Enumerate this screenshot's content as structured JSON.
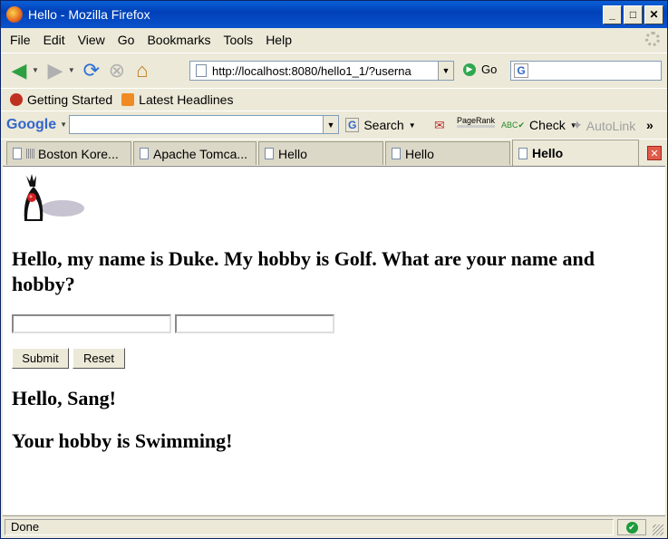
{
  "window": {
    "title": "Hello - Mozilla Firefox",
    "minimize": "_",
    "maximize": "□",
    "close": "✕"
  },
  "menu": [
    "File",
    "Edit",
    "View",
    "Go",
    "Bookmarks",
    "Tools",
    "Help"
  ],
  "nav": {
    "url": "http://localhost:8080/hello1_1/?userna",
    "go_label": "Go"
  },
  "bookmarks": [
    {
      "label": "Getting Started"
    },
    {
      "label": "Latest Headlines"
    }
  ],
  "google_bar": {
    "logo": "Google",
    "search_label": "Search",
    "pagerank_label": "PageRank",
    "check_label": "Check",
    "autolink_label": "AutoLink",
    "more": "»"
  },
  "tabs": [
    {
      "label": "Boston Kore..."
    },
    {
      "label": "Apache Tomca..."
    },
    {
      "label": "Hello"
    },
    {
      "label": "Hello"
    },
    {
      "label": "Hello",
      "active": true
    }
  ],
  "page": {
    "question": "Hello, my name is Duke. My hobby is Golf. What are your name and hobby?",
    "name_value": "",
    "hobby_value": "",
    "submit_label": "Submit",
    "reset_label": "Reset",
    "greeting": "Hello, Sang!",
    "hobby_response": "Your hobby is Swimming!"
  },
  "status": {
    "text": "Done"
  },
  "colors": {
    "titlebar": "#0a53cc",
    "chrome": "#ece9d8"
  }
}
